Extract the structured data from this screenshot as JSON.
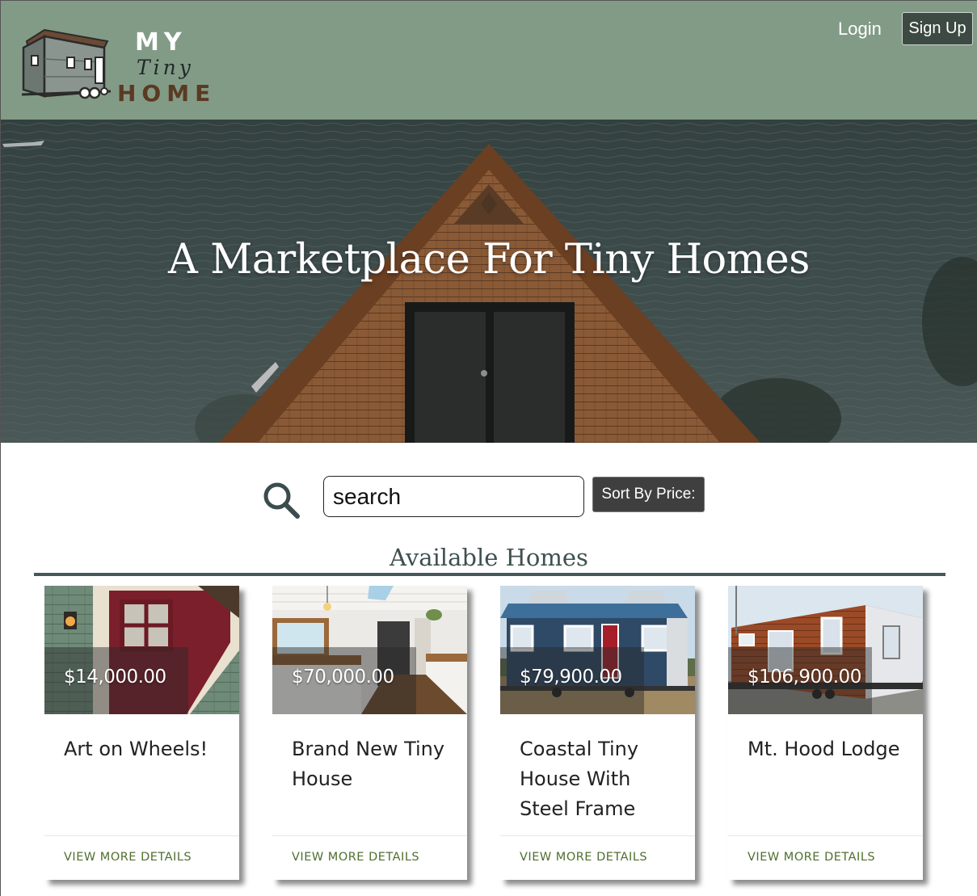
{
  "header": {
    "logo": {
      "line1": "MY",
      "line2": "Tiny",
      "line3": "HOME"
    },
    "login_label": "Login",
    "signup_label": "Sign Up",
    "background_color": "#829b86"
  },
  "hero": {
    "title": "A Marketplace For Tiny Homes"
  },
  "search": {
    "placeholder": "search",
    "icon": "magnifier-icon",
    "sort_label": "Sort By Price:"
  },
  "listings": {
    "heading": "Available Homes",
    "cards": [
      {
        "price": "$14,000.00",
        "title": "Art on Wheels!",
        "link": "VIEW MORE DETAILS"
      },
      {
        "price": "$70,000.00",
        "title": "Brand New Tiny House",
        "link": "VIEW MORE DETAILS"
      },
      {
        "price": "$79,900.00",
        "title": "Coastal Tiny House With Steel Frame",
        "link": "VIEW MORE DETAILS"
      },
      {
        "price": "$106,900.00",
        "title": "Mt. Hood Lodge",
        "link": "VIEW MORE DETAILS"
      }
    ]
  },
  "colors": {
    "accent_link": "#4f6f2f",
    "rule": "#45575a",
    "button_dark": "#3f3f3f"
  }
}
